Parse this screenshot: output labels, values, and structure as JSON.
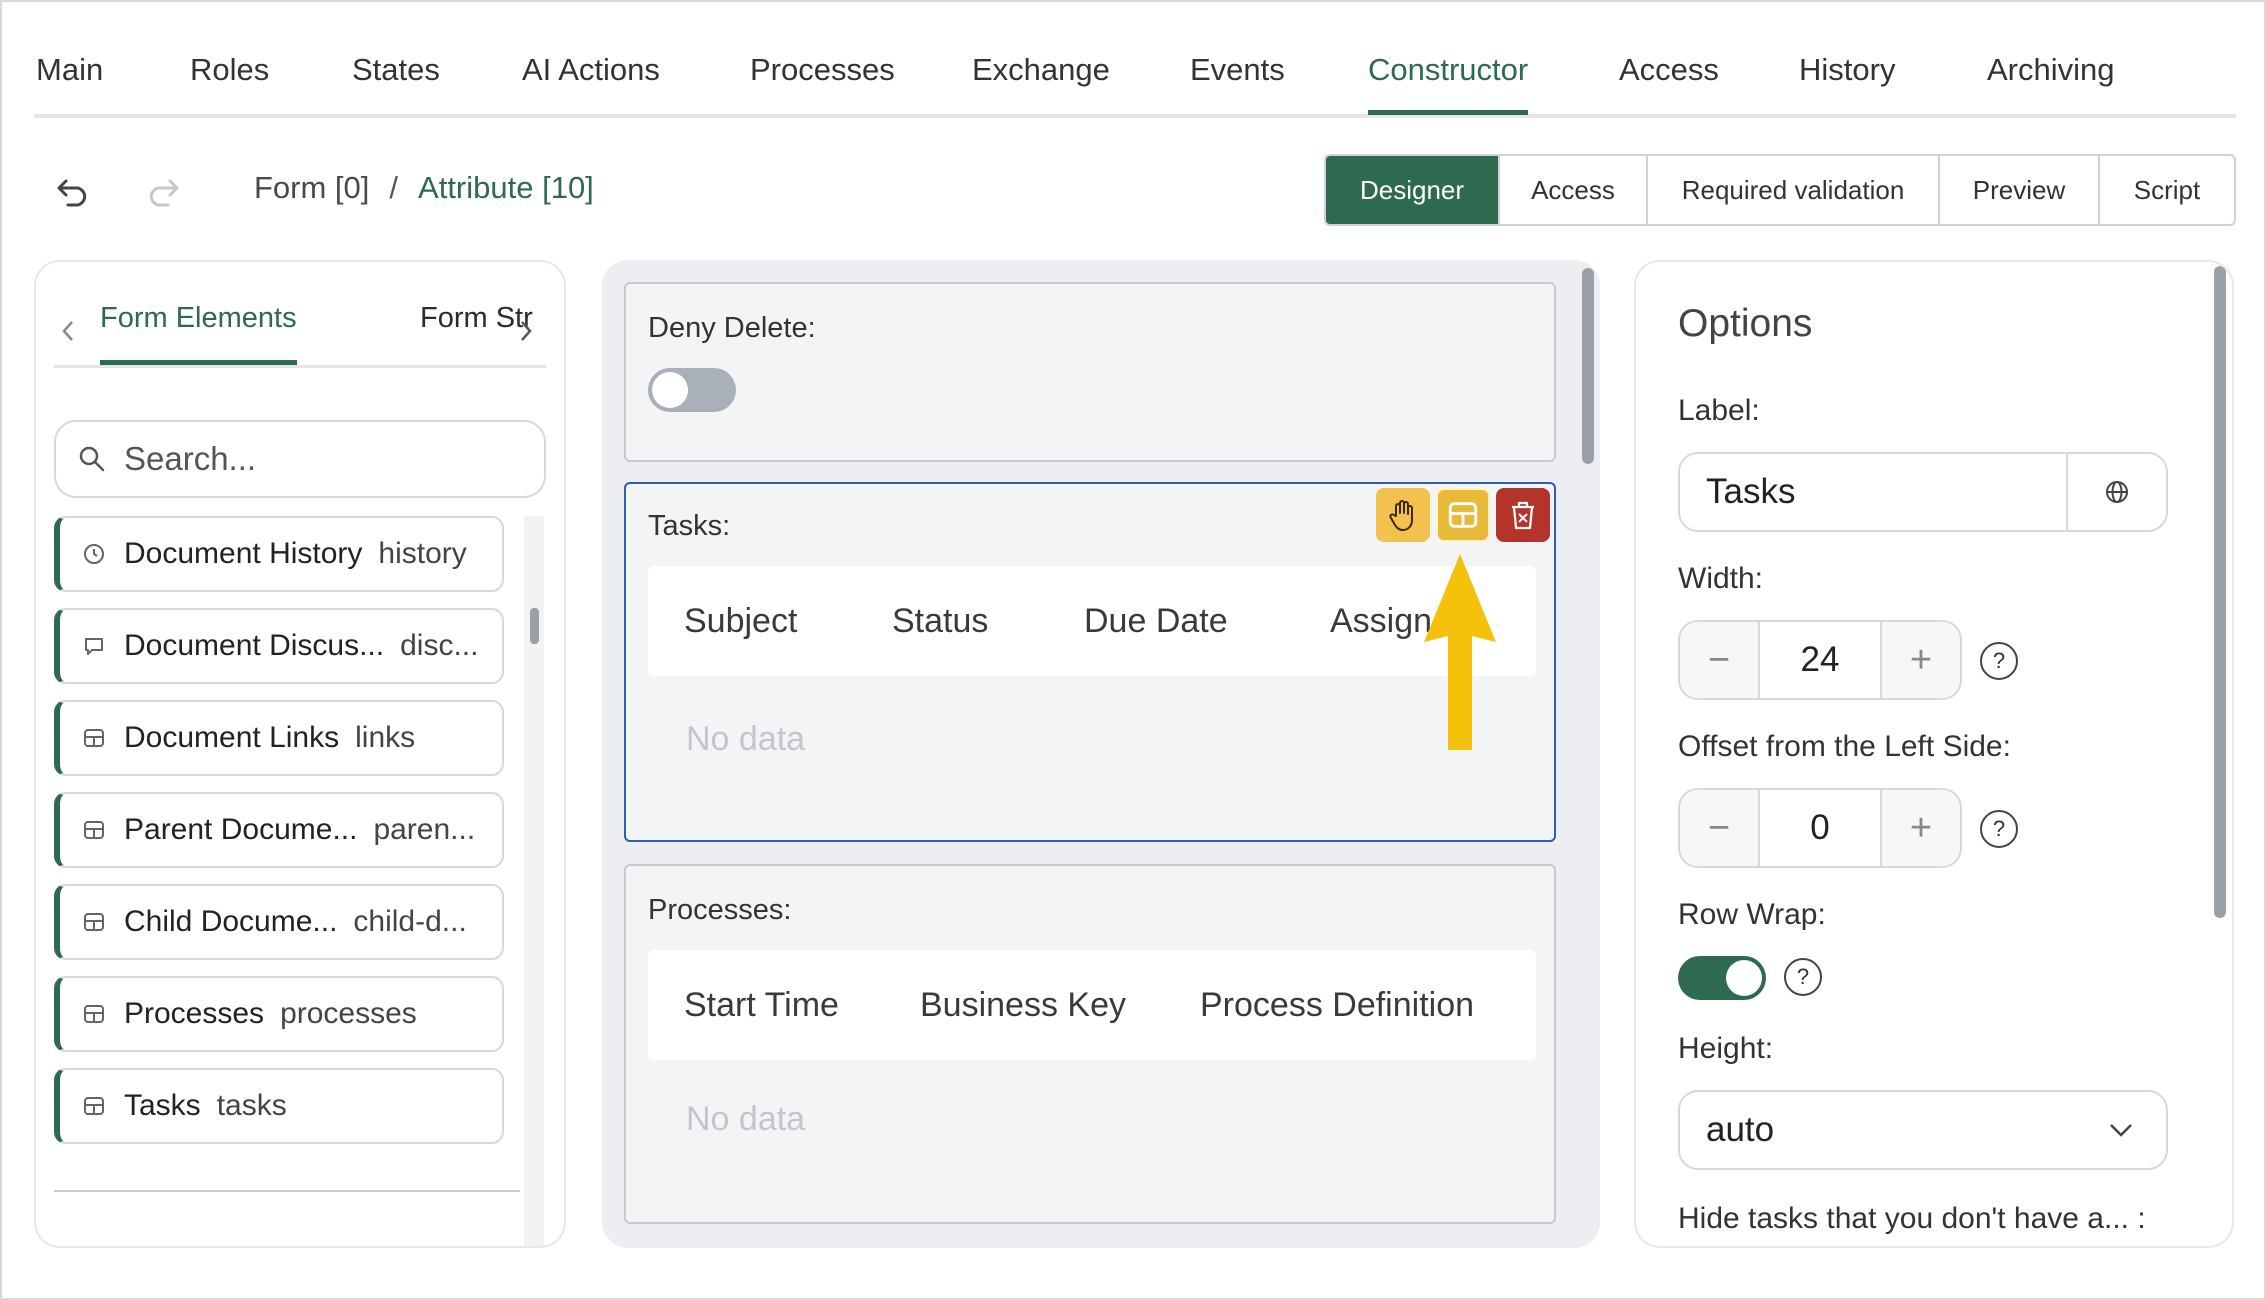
{
  "topnav": {
    "tabs": [
      {
        "label": "Main"
      },
      {
        "label": "Roles"
      },
      {
        "label": "States"
      },
      {
        "label": "AI Actions"
      },
      {
        "label": "Processes"
      },
      {
        "label": "Exchange"
      },
      {
        "label": "Events"
      },
      {
        "label": "Constructor",
        "active": true
      },
      {
        "label": "Access"
      },
      {
        "label": "History"
      },
      {
        "label": "Archiving"
      }
    ]
  },
  "breadcrumb": {
    "form": "Form [0]",
    "separator": "/",
    "attribute": "Attribute [10]"
  },
  "mode_tabs": [
    {
      "label": "Designer",
      "active": true
    },
    {
      "label": "Access"
    },
    {
      "label": "Required validation"
    },
    {
      "label": "Preview"
    },
    {
      "label": "Script"
    }
  ],
  "left_panel": {
    "tabs": [
      {
        "label": "Form Elements",
        "active": true
      },
      {
        "label": "Form Str"
      }
    ],
    "search_placeholder": "Search...",
    "items": [
      {
        "name": "Document History",
        "key": "history",
        "icon": "clock-icon"
      },
      {
        "name": "Document Discus...",
        "key": "disc...",
        "icon": "comment-icon"
      },
      {
        "name": "Document Links",
        "key": "links",
        "icon": "table-icon"
      },
      {
        "name": "Parent Docume...",
        "key": "paren...",
        "icon": "table-icon"
      },
      {
        "name": "Child Docume...",
        "key": "child-d...",
        "icon": "table-icon"
      },
      {
        "name": "Processes",
        "key": "processes",
        "icon": "table-icon"
      },
      {
        "name": "Tasks",
        "key": "tasks",
        "icon": "table-icon"
      }
    ]
  },
  "canvas": {
    "deny_delete": {
      "label": "Deny Delete:",
      "value": false
    },
    "tasks": {
      "label": "Tasks:",
      "columns": [
        "Subject",
        "Status",
        "Due Date",
        "Assigne"
      ],
      "empty_text": "No data"
    },
    "processes": {
      "label": "Processes:",
      "columns": [
        "Start Time",
        "Business Key",
        "Process Definition"
      ],
      "empty_text": "No data"
    }
  },
  "options": {
    "title": "Options",
    "label_field": {
      "label": "Label:",
      "value": "Tasks"
    },
    "width": {
      "label": "Width:",
      "value": "24"
    },
    "offset": {
      "label": "Offset from the Left Side:",
      "value": "0"
    },
    "row_wrap": {
      "label": "Row Wrap:",
      "value": true
    },
    "height": {
      "label": "Height:",
      "value": "auto"
    },
    "hide_tasks": {
      "label": "Hide tasks that you don't have a... :"
    },
    "help_symbol": "?",
    "minus": "−",
    "plus": "+"
  },
  "colors": {
    "accent": "#2d6a4f",
    "drag_button": "#f2c14e",
    "layout_button": "#e9b93a",
    "delete_button": "#b4332a",
    "annotation_arrow": "#f5c10a"
  }
}
